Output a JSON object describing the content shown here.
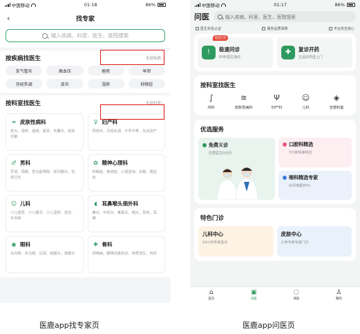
{
  "left": {
    "status": {
      "carrier": "中国移动",
      "time": "01:18",
      "battery": "86%"
    },
    "nav": {
      "back": "‹",
      "title": "找专家"
    },
    "search": {
      "placeholder": "输入疾病、科室、医生、医院搜索"
    },
    "by_disease": {
      "title": "按疾病找医生",
      "more": "全部疾病 ›",
      "tags": [
        "支气管炎",
        "高血压",
        "痤疮",
        "早泄",
        "月经失调",
        "皮炎",
        "湿疹",
        "抑郁症"
      ]
    },
    "by_dept": {
      "title": "按科室找医生",
      "more": "全部科室 ›",
      "items": [
        {
          "icon": "skin-icon",
          "glyph": "≈",
          "name": "皮肤性病科",
          "desc": "皮炎、湿疹、痤疮、脱发、毛囊炎、皮肤过敏"
        },
        {
          "icon": "uterus-icon",
          "glyph": "♀",
          "name": "妇产科",
          "desc": "阴道炎、月经失调、不孕不育、先兆流产"
        },
        {
          "icon": "male-icon",
          "glyph": "♂",
          "name": "男科",
          "desc": "早泄、阳痿、性功能障碍、前列腺炎、包皮过长"
        },
        {
          "icon": "brain-icon",
          "glyph": "✿",
          "name": "精神心理科",
          "desc": "抑郁症、焦虑症、心理咨询、失眠、强迫症"
        },
        {
          "icon": "child-icon",
          "glyph": "☺",
          "name": "儿科",
          "desc": "小儿感冒、小儿腹泻、小儿湿疹、发烧、长身高"
        },
        {
          "icon": "ear-icon",
          "glyph": "◖",
          "name": "耳鼻喉头颈外科",
          "desc": "鼻炎、中耳炎、鼻窦炎、咽炎、耳鸣、耳聋"
        },
        {
          "icon": "eye-icon",
          "glyph": "◉",
          "name": "眼科",
          "desc": "白内障、青光眼、近视、结膜炎、角膜炎"
        },
        {
          "icon": "bone-icon",
          "glyph": "✚",
          "name": "骨科",
          "desc": "颈椎病、腰椎间盘突出、骨质增生、骨折"
        }
      ]
    },
    "caption": "医鹿app找专家页"
  },
  "right": {
    "status": {
      "carrier": "中国移动",
      "time": "01:17",
      "battery": "86%"
    },
    "header": {
      "logo": "问医",
      "search_placeholder": "输入疾病、科室、医生、医院搜索"
    },
    "trust": [
      "医生实名认证",
      "服务品质保障",
      "平台安全放心"
    ],
    "quick": [
      {
        "icon": "chat-icon",
        "glyph": "!",
        "title": "极速问诊",
        "sub": "60秒医生接诊",
        "badge": "低至5元"
      },
      {
        "icon": "prescription-icon",
        "glyph": "✚",
        "title": "复诊开药",
        "sub": "正品好药送上门",
        "badge": ""
      }
    ],
    "dept_section": {
      "title": "按科室找医生",
      "items": [
        {
          "icon": "stethoscope-icon",
          "glyph": "∫",
          "label": "内科"
        },
        {
          "icon": "skin-icon",
          "glyph": "≋",
          "label": "皮肤性病科"
        },
        {
          "icon": "uterus-icon",
          "glyph": "Ψ",
          "label": "妇产科"
        },
        {
          "icon": "child-icon",
          "glyph": "☺",
          "label": "儿科"
        },
        {
          "icon": "layers-icon",
          "glyph": "◈",
          "label": "全部科室"
        }
      ]
    },
    "services": {
      "title": "优选服务",
      "big": {
        "title": "免费义诊",
        "sub": "优质医生0元问"
      },
      "small": [
        {
          "title": "口腔科精选",
          "sub": "5分钟快速响应",
          "bg": "#fdeef2",
          "dot": "#e8567b"
        },
        {
          "title": "眼科精选专家",
          "sub": "好评率超95%",
          "bg": "#eaf1fb",
          "dot": "#3d7fd6"
        }
      ]
    },
    "featured": {
      "title": "特色门诊",
      "items": [
        {
          "title": "儿科中心",
          "sub": "24小时专家急诊",
          "bg": "#fdf3e4"
        },
        {
          "title": "皮肤中心",
          "sub": "三甲专家专属门诊",
          "bg": "#e9f2fb"
        }
      ]
    },
    "tabs": [
      {
        "icon": "home-icon",
        "glyph": "⌂",
        "label": "首页",
        "active": false
      },
      {
        "icon": "clipboard-icon",
        "glyph": "▣",
        "label": "问医",
        "active": true
      },
      {
        "icon": "message-icon",
        "glyph": "◌",
        "label": "消息",
        "active": false
      },
      {
        "icon": "person-icon",
        "glyph": "♙",
        "label": "我的",
        "active": false
      }
    ],
    "caption": "医鹿app问医页"
  },
  "colors": {
    "brand_green": "#2e9a5f",
    "highlight_red": "#dd1111"
  }
}
